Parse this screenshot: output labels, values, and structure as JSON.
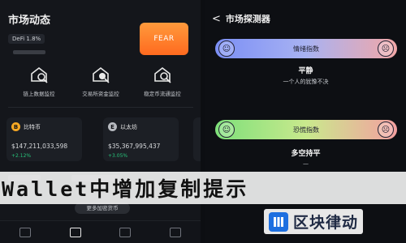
{
  "left": {
    "header": {
      "title": "市场动态"
    },
    "tag": "DeFi 1.8%",
    "fear_badge": "FEAR",
    "quick": [
      {
        "label": "链上数据监控",
        "icon": "house-search-icon"
      },
      {
        "label": "交易所资金监控",
        "icon": "exchange-search-icon"
      },
      {
        "label": "稳定币流通监控",
        "icon": "stablecoin-search-icon"
      }
    ],
    "cards": [
      {
        "coin": "B",
        "name": "比特币",
        "value": "$147,211,033,598",
        "change": "+2.12%",
        "color": "#f7a823"
      },
      {
        "coin": "E",
        "name": "以太坊",
        "value": "$35,367,995,437",
        "change": "+3.05%",
        "color": "#b7bac0"
      },
      {
        "coin": "",
        "name": "",
        "value": "",
        "change": "",
        "color": "#3a3d44"
      }
    ],
    "pill": "更多加密货币",
    "overlay_text": "Wallet中增加复制提示"
  },
  "right": {
    "header": {
      "title": "市场探测器",
      "back": "<"
    },
    "gauge1": {
      "label": "情绪指数",
      "left_face": "☺",
      "right_face": "☹"
    },
    "state1": {
      "title": "平静",
      "sub": "一个人的犹豫不决"
    },
    "gauge2": {
      "label": "恐慌指数",
      "left_face": "☺",
      "right_face": "☹"
    },
    "state2": {
      "title": "多空持平",
      "sub": "—"
    },
    "brand": "区块律动"
  }
}
